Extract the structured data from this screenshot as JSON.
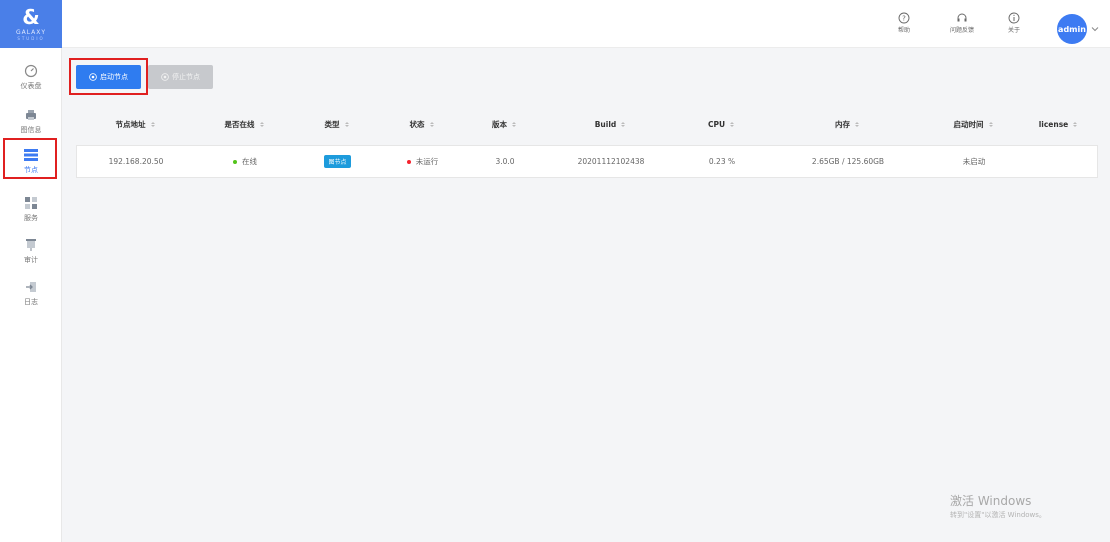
{
  "app": {
    "logo_text": "GALAXY",
    "logo_sub": "STUDIO"
  },
  "sidebar": {
    "items": [
      {
        "label": "仪表盘",
        "icon": "dashboard-icon"
      },
      {
        "label": "图信息",
        "icon": "printer-icon"
      },
      {
        "label": "节点",
        "icon": "node-list-icon",
        "active": true
      },
      {
        "label": "服务",
        "icon": "services-icon"
      },
      {
        "label": "审计",
        "icon": "audit-icon"
      },
      {
        "label": "日志",
        "icon": "log-icon"
      }
    ]
  },
  "header": {
    "help_label": "帮助",
    "feedback_label": "问题反馈",
    "about_label": "关于",
    "user": "admin"
  },
  "toolbar": {
    "start_label": "启动节点",
    "stop_label": "停止节点"
  },
  "table": {
    "columns": [
      "节点地址",
      "是否在线",
      "类型",
      "状态",
      "版本",
      "Build",
      "CPU",
      "内存",
      "启动时间",
      "license"
    ],
    "rows": [
      {
        "address": "192.168.20.50",
        "online": "在线",
        "type": "图节点",
        "status": "未运行",
        "version": "3.0.0",
        "build": "20201112102438",
        "cpu": "0.23 %",
        "memory": "2.65GB / 125.60GB",
        "start_time": "未启动",
        "license": ""
      }
    ]
  },
  "watermark": {
    "line1": "激活 Windows",
    "line2": "转到\"设置\"以激活 Windows。"
  },
  "colors": {
    "primary": "#2f7cf0",
    "online": "#52c41a",
    "stopped": "#f5222d",
    "tag": "#1d9bdc"
  }
}
